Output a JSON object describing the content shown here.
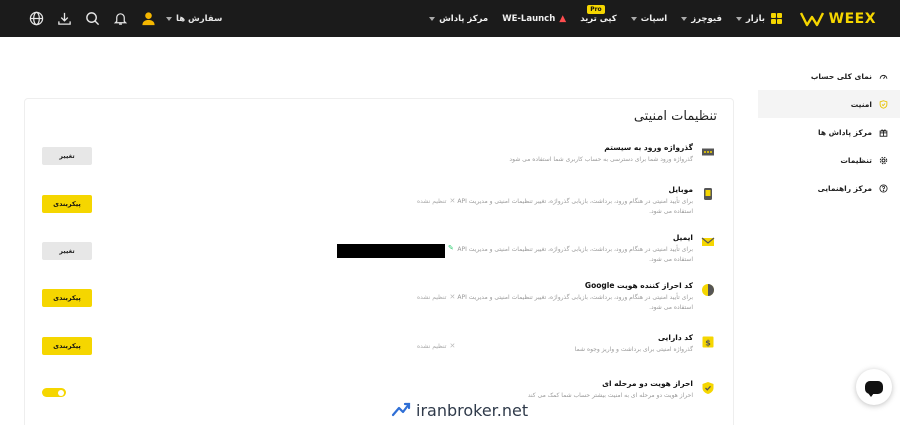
{
  "topbar": {
    "logo_text": "WEEX",
    "nav": [
      {
        "label": "بازار",
        "has_caret": true
      },
      {
        "label": "فیوچرز",
        "has_caret": true
      },
      {
        "label": "اسپات",
        "has_caret": true
      },
      {
        "label": "کپی ترید",
        "badge": "Pro"
      },
      {
        "label": "WE-Launch"
      },
      {
        "label": "مرکز پاداش",
        "has_caret": true
      }
    ],
    "orders_label": "سفارش ها",
    "icons": [
      "avatar-icon",
      "bell-icon",
      "search-icon",
      "download-icon",
      "globe-icon"
    ]
  },
  "sidebar": {
    "items": [
      {
        "label": "نمای کلی حساب",
        "icon": "gauge-icon",
        "active": false
      },
      {
        "label": "امنیت",
        "icon": "shield-icon",
        "active": true
      },
      {
        "label": "مرکز پاداش ها",
        "icon": "gift-icon",
        "active": false
      },
      {
        "label": "تنظیمات",
        "icon": "gear-icon",
        "active": false
      },
      {
        "label": "مرکز راهنمایی",
        "icon": "help-icon",
        "active": false
      }
    ]
  },
  "security": {
    "title": "تنظیمات امنیتی",
    "rows": [
      {
        "title": "گذرواژه ورود به سیستم",
        "desc": "گذرواژه ورود شما برای دسترسی به حساب کاربری شما استفاده می شود",
        "status": "",
        "action": "تغییر",
        "action_style": "gray",
        "icon": "password-icon"
      },
      {
        "title": "موبایل",
        "desc": "برای تأیید امنیتی در هنگام ورود، برداشت، بازیابی گذرواژه، تغییر تنظیمات امنیتی و مدیریت API استفاده می شود.",
        "status": "تنظیم نشده",
        "action": "پیکربندی",
        "action_style": "yellow",
        "icon": "mobile-icon"
      },
      {
        "title": "ایمیل",
        "desc": "برای تأیید امنیتی در هنگام ورود، برداشت، بازیابی گذرواژه، تغییر تنظیمات امنیتی و مدیریت API استفاده می شود.",
        "status": "",
        "action": "تغییر",
        "action_style": "gray",
        "icon": "mail-icon"
      },
      {
        "title": "کد احراز کننده هویت Google",
        "desc": "برای تأیید امنیتی در هنگام ورود، برداشت، بازیابی گذرواژه، تغییر تنظیمات امنیتی و مدیریت API استفاده می شود.",
        "status": "تنظیم نشده",
        "action": "پیکربندی",
        "action_style": "yellow",
        "icon": "google-auth-icon"
      },
      {
        "title": "کد دارایی",
        "desc": "گذرواژه امنیتی برای برداشت و واریز وجوه شما",
        "status": "تنظیم نشده",
        "action": "پیکربندی",
        "action_style": "yellow",
        "icon": "asset-code-icon"
      },
      {
        "title": "احراز هویت دو مرحله ای",
        "desc": "احراز هویت دو مرحله ای به امنیت بیشتر حساب شما کمک می کند",
        "status": "",
        "action": "",
        "action_style": "toggle",
        "icon": "shield-check-icon"
      }
    ]
  },
  "watermark": {
    "text": "iranbroker.net"
  },
  "colors": {
    "accent": "#f5d600",
    "topbar": "#1b1b1b"
  }
}
